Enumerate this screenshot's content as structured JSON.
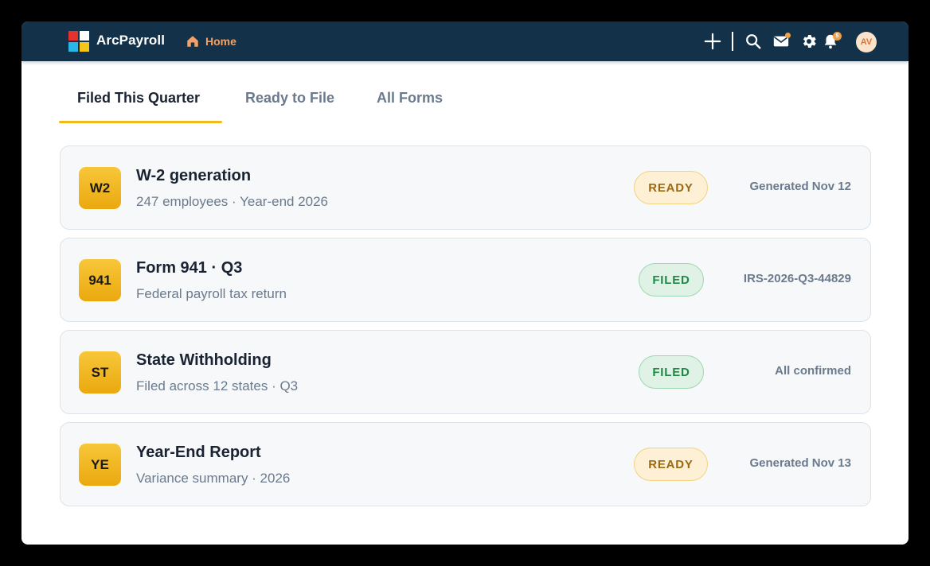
{
  "app": {
    "brand": "ArcPayroll",
    "logo_colors": [
      "#e5322d",
      "#ffffff",
      "#29b6e8",
      "#f5c518"
    ]
  },
  "nav": {
    "home_label": "Home",
    "home_icon": "home-icon",
    "notification_count": "5",
    "avatar_initials": "AV",
    "icons": [
      "plus-icon",
      "search-icon",
      "mail-icon",
      "gear-icon",
      "bell-icon"
    ]
  },
  "tabs": [
    {
      "label": "Filed This Quarter",
      "active": true
    },
    {
      "label": "Ready to File",
      "active": false
    },
    {
      "label": "All Forms",
      "active": false
    }
  ],
  "forms": [
    {
      "code": "W2",
      "title": "W-2 generation",
      "subtitle": "247 employees · Year-end 2026",
      "status": "READY",
      "meta": "Generated Nov 12"
    },
    {
      "code": "941",
      "title": "Form 941 · Q3",
      "subtitle": "Federal payroll tax return",
      "status": "FILED",
      "meta": "IRS-2026-Q3-44829"
    },
    {
      "code": "ST",
      "title": "State Withholding",
      "subtitle": "Filed across 12 states · Q3",
      "status": "FILED",
      "meta": "All confirmed"
    },
    {
      "code": "YE",
      "title": "Year-End Report",
      "subtitle": "Variance summary · 2026",
      "status": "READY",
      "meta": "Generated Nov 13"
    }
  ],
  "colors": {
    "topbar": "#133149",
    "accent": "#f2b91c",
    "home_accent": "#f2a268",
    "ready_text": "#9a6a12",
    "filed_text": "#1f8a47"
  }
}
